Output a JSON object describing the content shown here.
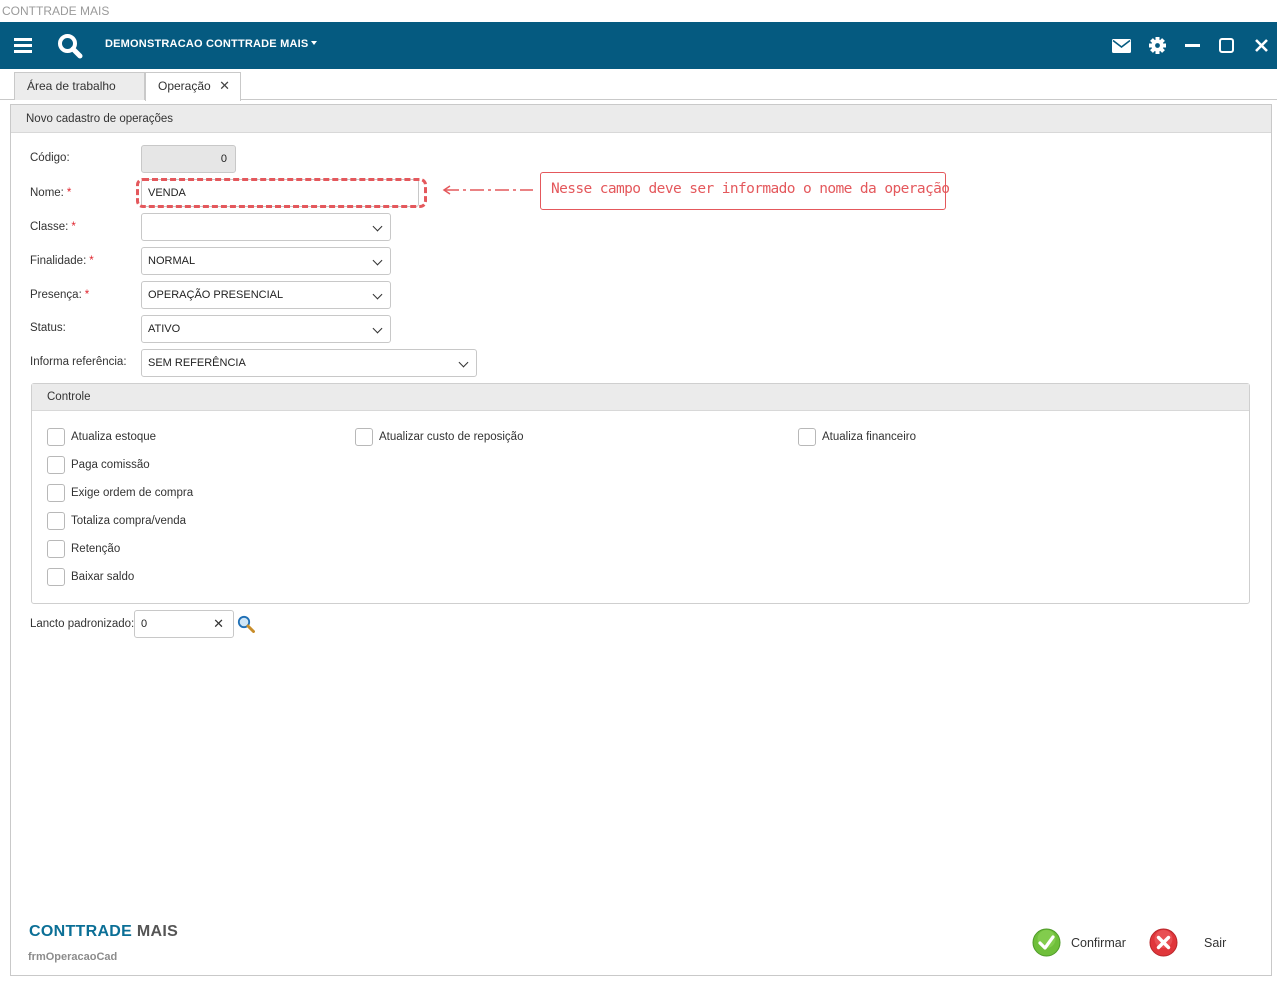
{
  "window": {
    "title": "CONTTRADE MAIS"
  },
  "topbar": {
    "company": "DEMONSTRACAO CONTTRADE MAIS",
    "accent": "#055a80",
    "left_icons": [
      "menu-icon",
      "search-icon"
    ],
    "right_icons": [
      "mail-icon",
      "gear-icon",
      "minimize-icon",
      "maximize-icon",
      "close-icon"
    ]
  },
  "tabs": [
    {
      "label": "Área de trabalho"
    },
    {
      "label": "Operação",
      "close": "✕"
    }
  ],
  "form": {
    "header": "Novo cadastro de operações",
    "codigo": {
      "label": "Código:",
      "value": "0"
    },
    "nome": {
      "label": "Nome:",
      "required": "*",
      "value": "VENDA"
    },
    "classe": {
      "label": "Classe:",
      "required": "*",
      "value": ""
    },
    "finalidade": {
      "label": "Finalidade:",
      "required": "*",
      "value": "NORMAL"
    },
    "presenca": {
      "label": "Presença:",
      "required": "*",
      "value": "OPERAÇÃO PRESENCIAL"
    },
    "status": {
      "label": "Status:",
      "value": "ATIVO"
    },
    "referencia": {
      "label": "Informa referência:",
      "value": "SEM REFERÊNCIA"
    },
    "annotation": "Nesse campo deve ser informado o nome da operação"
  },
  "controle": {
    "title": "Controle",
    "checkboxes": [
      {
        "label": "Atualiza estoque",
        "checked": false
      },
      {
        "label": "Atualizar custo de reposição",
        "checked": false
      },
      {
        "label": "Atualiza financeiro",
        "checked": false
      },
      {
        "label": "Paga comissão",
        "checked": false
      },
      {
        "label": "Exige ordem de compra",
        "checked": false
      },
      {
        "label": "Totaliza compra/venda",
        "checked": false
      },
      {
        "label": "Retenção",
        "checked": false
      },
      {
        "label": "Baixar saldo",
        "checked": false
      }
    ]
  },
  "lancto": {
    "label": "Lancto padronizado:",
    "value": "0",
    "clear": "✕"
  },
  "footer": {
    "brand_main": "CONTTRADE",
    "brand_sub": "MAIS",
    "form_name": "frmOperacaoCad",
    "confirm_label": "Confirmar",
    "exit_label": "Sair"
  }
}
